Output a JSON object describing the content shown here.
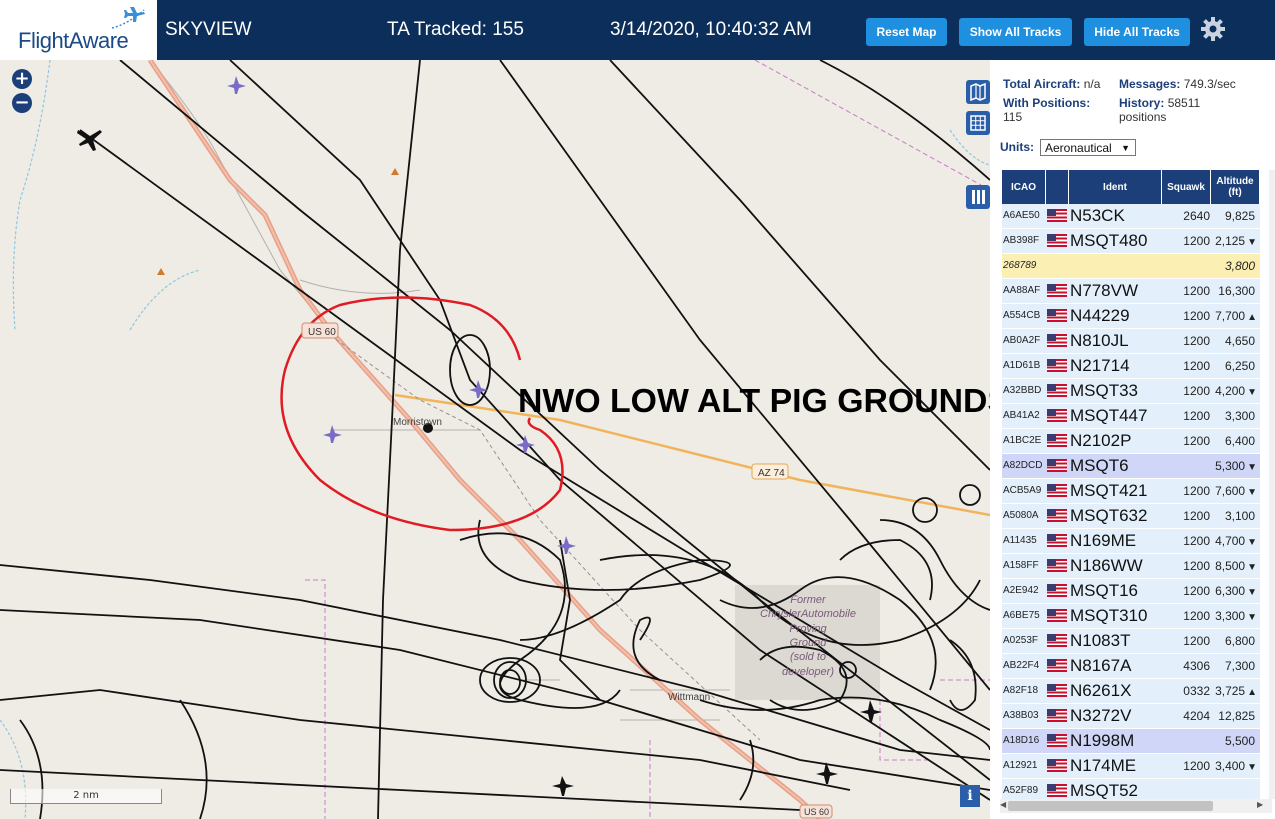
{
  "header": {
    "logo_text": "FlightAware",
    "site_name": "SKYVIEW",
    "tracked": "TA Tracked: 155",
    "datetime": "3/14/2020, 10:40:32 AM",
    "buttons": {
      "reset": "Reset Map",
      "show_all": "Show All Tracks",
      "hide_all": "Hide All Tracks"
    },
    "settings_icon": "gear-icon"
  },
  "map": {
    "zoom_in": "+",
    "zoom_out": "−",
    "scale_label": "2 nm",
    "info_label": "i",
    "annotation": "NWO LOW ALT PIG GROUNDS",
    "labels": {
      "town_morristown": "Morristown",
      "town_wittmann": "Wittmann",
      "road_us60": "US 60",
      "road_az74": "AZ 74",
      "road_us60_bottom": "US 60",
      "proving_ground": [
        "Former",
        "ChryslerAutomobile",
        "Proving",
        "Ground",
        "(sold to",
        "developer)"
      ]
    },
    "icons": [
      "map-layers-icon",
      "grid-icon",
      "columns-icon"
    ]
  },
  "panel": {
    "total_label": "Total Aircraft:",
    "total_value": "n/a",
    "messages_label": "Messages:",
    "messages_value": "749.3/sec",
    "positions_label": "With Positions:",
    "positions_value": "115",
    "history_label": "History:",
    "history_value": "58511",
    "history_unit": "positions",
    "units_label": "Units:",
    "units_value": "Aeronautical",
    "columns": [
      "ICAO",
      "",
      "Ident",
      "Squawk",
      "Altitude (ft)"
    ],
    "rows": [
      {
        "icao": "A6AE50",
        "ident": "N53CK",
        "squawk": "2640",
        "alt": "9,825",
        "trend": "",
        "style": ""
      },
      {
        "icao": "AB398F",
        "ident": "MSQT480",
        "squawk": "1200",
        "alt": "2,125",
        "trend": "▼",
        "style": ""
      },
      {
        "icao": "268789",
        "ident": "",
        "squawk": "",
        "alt": "3,800",
        "trend": "",
        "style": "yellow"
      },
      {
        "icao": "AA88AF",
        "ident": "N778VW",
        "squawk": "1200",
        "alt": "16,300",
        "trend": "",
        "style": ""
      },
      {
        "icao": "A554CB",
        "ident": "N44229",
        "squawk": "1200",
        "alt": "7,700",
        "trend": "▲",
        "style": ""
      },
      {
        "icao": "AB0A2F",
        "ident": "N810JL",
        "squawk": "1200",
        "alt": "4,650",
        "trend": "",
        "style": ""
      },
      {
        "icao": "A1D61B",
        "ident": "N21714",
        "squawk": "1200",
        "alt": "6,250",
        "trend": "",
        "style": ""
      },
      {
        "icao": "A32BBD",
        "ident": "MSQT33",
        "squawk": "1200",
        "alt": "4,200",
        "trend": "▼",
        "style": ""
      },
      {
        "icao": "AB41A2",
        "ident": "MSQT447",
        "squawk": "1200",
        "alt": "3,300",
        "trend": "",
        "style": ""
      },
      {
        "icao": "A1BC2E",
        "ident": "N2102P",
        "squawk": "1200",
        "alt": "6,400",
        "trend": "",
        "style": ""
      },
      {
        "icao": "A82DCD",
        "ident": "MSQT6",
        "squawk": "",
        "alt": "5,300",
        "trend": "▼",
        "style": "sel"
      },
      {
        "icao": "ACB5A9",
        "ident": "MSQT421",
        "squawk": "1200",
        "alt": "7,600",
        "trend": "▼",
        "style": ""
      },
      {
        "icao": "A5080A",
        "ident": "MSQT632",
        "squawk": "1200",
        "alt": "3,100",
        "trend": "",
        "style": ""
      },
      {
        "icao": "A11435",
        "ident": "N169ME",
        "squawk": "1200",
        "alt": "4,700",
        "trend": "▼",
        "style": ""
      },
      {
        "icao": "A158FF",
        "ident": "N186WW",
        "squawk": "1200",
        "alt": "8,500",
        "trend": "▼",
        "style": ""
      },
      {
        "icao": "A2E942",
        "ident": "MSQT16",
        "squawk": "1200",
        "alt": "6,300",
        "trend": "▼",
        "style": ""
      },
      {
        "icao": "A6BE75",
        "ident": "MSQT310",
        "squawk": "1200",
        "alt": "3,300",
        "trend": "▼",
        "style": ""
      },
      {
        "icao": "A0253F",
        "ident": "N1083T",
        "squawk": "1200",
        "alt": "6,800",
        "trend": "",
        "style": ""
      },
      {
        "icao": "AB22F4",
        "ident": "N8167A",
        "squawk": "4306",
        "alt": "7,300",
        "trend": "",
        "style": ""
      },
      {
        "icao": "A82F18",
        "ident": "N6261X",
        "squawk": "0332",
        "alt": "3,725",
        "trend": "▲",
        "style": ""
      },
      {
        "icao": "A38B03",
        "ident": "N3272V",
        "squawk": "4204",
        "alt": "12,825",
        "trend": "",
        "style": ""
      },
      {
        "icao": "A18D16",
        "ident": "N1998M",
        "squawk": "",
        "alt": "5,500",
        "trend": "",
        "style": "sel"
      },
      {
        "icao": "A12921",
        "ident": "N174ME",
        "squawk": "1200",
        "alt": "3,400",
        "trend": "▼",
        "style": ""
      },
      {
        "icao": "A52F89",
        "ident": "MSQT52",
        "squawk": "",
        "alt": "",
        "trend": "",
        "style": ""
      }
    ]
  },
  "colors": {
    "header_bg": "#0b2e5a",
    "button_bg": "#1f8fe0",
    "table_header": "#1c3f7a",
    "row_bg": "#e3f0fb",
    "row_yellow": "#fcefb4",
    "row_selected": "#cfd6f7",
    "annotation_red": "#e01b24"
  }
}
